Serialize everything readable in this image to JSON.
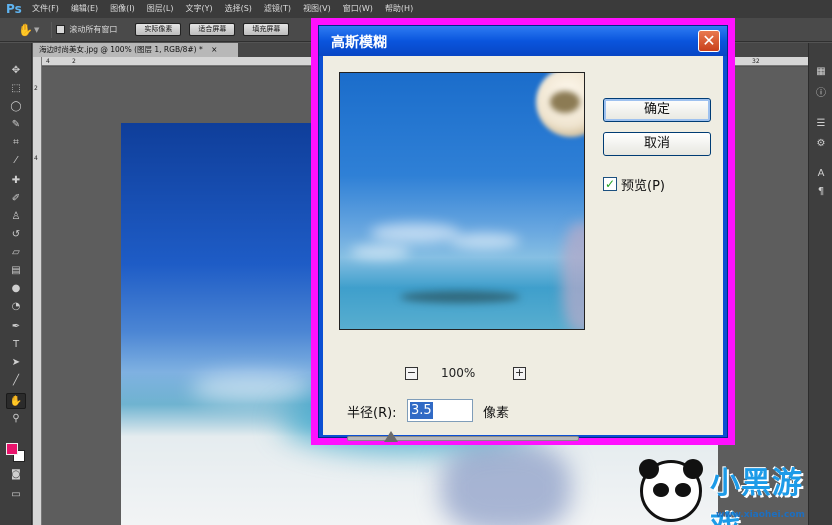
{
  "app": {
    "logo": "Ps"
  },
  "menu": [
    "文件(F)",
    "编辑(E)",
    "图像(I)",
    "图层(L)",
    "文字(Y)",
    "选择(S)",
    "滤镜(T)",
    "视图(V)",
    "窗口(W)",
    "帮助(H)"
  ],
  "options_bar": {
    "scroll_all_label": "滚动所有窗口",
    "buttons": [
      "实际像素",
      "适合屏幕",
      "填充屏幕"
    ]
  },
  "document": {
    "tab_title": "海边时尚美女.jpg @ 100% (图层 1, RGB/8#) *",
    "tab_close": "×"
  },
  "rulers": {
    "h_ticks": [
      "4",
      "2",
      "32"
    ],
    "v_ticks": [
      "2",
      "4"
    ]
  },
  "colors": {
    "foreground": "#e8146c",
    "background": "#ffffff",
    "dialog_frame": "#ff10ff",
    "titlebar": "#0a55dd"
  },
  "dialog": {
    "title": "高斯模糊",
    "close_glyph": "✕",
    "ok_label": "确定",
    "cancel_label": "取消",
    "preview_label": "预览(P)",
    "preview_checked": true,
    "zoom_minus": "−",
    "zoom_plus": "+",
    "zoom_value": "100%",
    "radius_label": "半径(R):",
    "radius_value": "3.5",
    "radius_unit": "像素",
    "radius_slider_fraction": 0.19
  },
  "watermark": {
    "text": "小黑游戏",
    "url": "www.xiaohei.com"
  }
}
